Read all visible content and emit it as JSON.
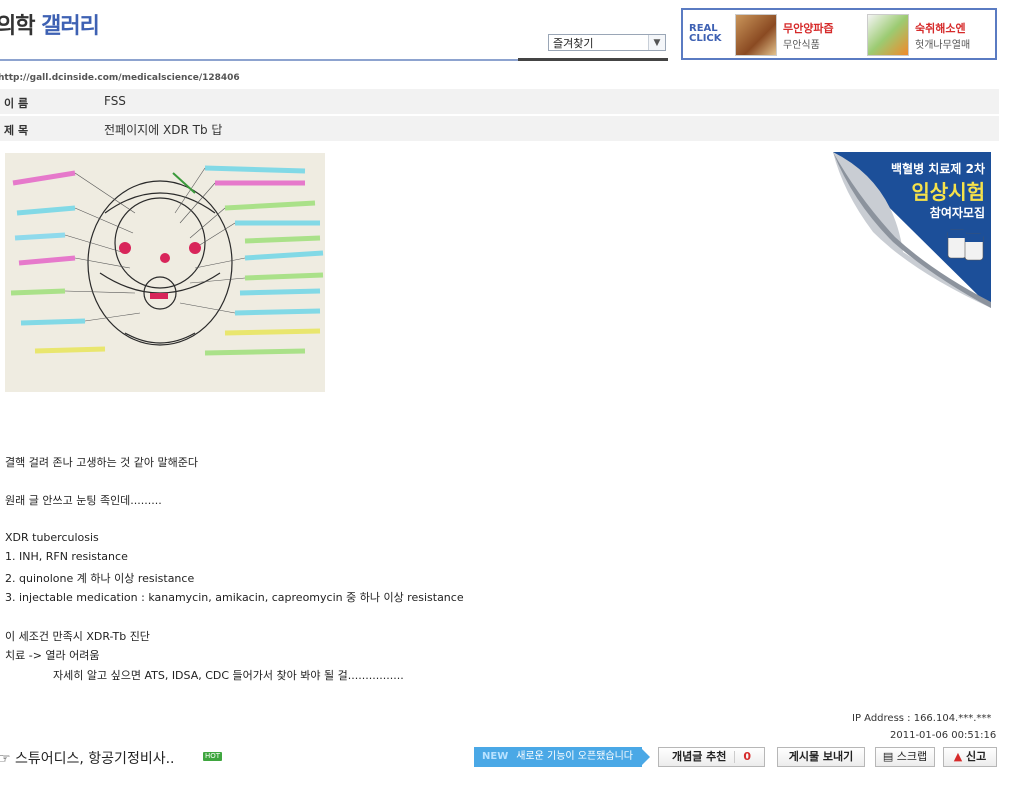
{
  "header": {
    "title_part1": "의학 ",
    "title_part2": "갤러리",
    "bookmark_select": "즐겨찾기"
  },
  "ad_top": {
    "label_line1": "REAL",
    "label_line2": "CLICK",
    "item1_title": "무안양파즙",
    "item1_sub": "무안식품",
    "item2_title": "숙취해소엔",
    "item2_sub": "헛개나무열매"
  },
  "post": {
    "url": "http://gall.dcinside.com/medicalscience/128406",
    "name_label": "이 름",
    "name_value": "FSS",
    "title_label": "제 목",
    "title_value": "전페이지에 XDR Tb 답",
    "body_lines": [
      "결핵 걸려 존나 고생하는 것 같아 말해준다",
      "원래 글 안쓰고 눈팅 족인데.........",
      "XDR tuberculosis",
      "1. INH, RFN resistance",
      "2. quinolone 계 하나 이상 resistance",
      "3. injectable medication : kanamycin, amikacin, capreomycin 중 하나 이상 resistance",
      "이 세조건 만족시 XDR-Tb 진단",
      "치료 -> 열라 어려움",
      "자세히 알고 싶으면 ATS, IDSA, CDC 들어가서 찾아 봐야 될 걸................"
    ],
    "ip_address": "IP Address : 166.104.***.***",
    "date": "2011-01-06 00:51:16"
  },
  "side_ad": {
    "line1": "백혈병 치료제 2차",
    "line2": "임상시험",
    "line3": "참여자모집"
  },
  "footer": {
    "related_link": "☞ 스튜어디스, 항공기정비사..",
    "hot_badge": "HOT",
    "new_tag": "NEW",
    "new_feature_text": "새로운 기능이 오픈됐습니다",
    "recommend_label": "개념글 추천",
    "recommend_count": "0",
    "send_label": "게시물 보내기",
    "scrap_label": "스크랩",
    "report_label": "신고"
  },
  "colors": {
    "accent_blue": "#3e61b3",
    "new_banner": "#4aa8e6",
    "alert_red": "#d62b2b"
  }
}
